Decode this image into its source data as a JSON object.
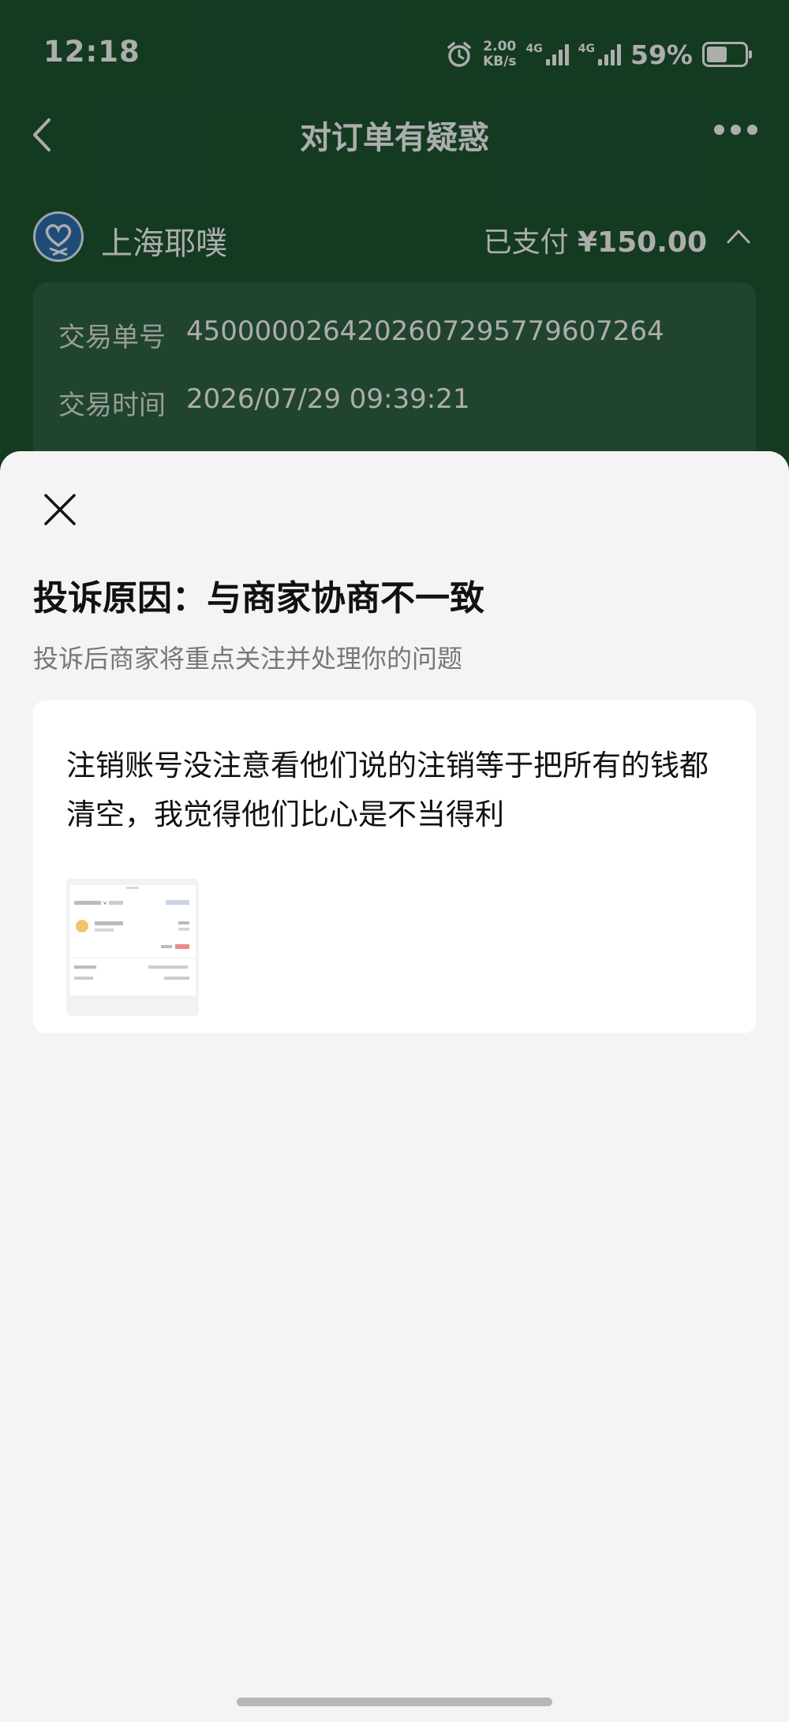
{
  "status_bar": {
    "time": "12:18",
    "net_speed_value": "2.00",
    "net_speed_unit": "KB/s",
    "sim1_tag": "4G",
    "sim2_tag": "4G",
    "battery_percent": "59%",
    "battery_level": 0.59
  },
  "navbar": {
    "title": "对订单有疑惑"
  },
  "merchant": {
    "name": "上海耶噗",
    "pay_status": "已支付",
    "amount": "¥150.00"
  },
  "order": {
    "trade_no_label": "交易单号",
    "trade_no": "4500000264202607295779607264",
    "trade_time_label": "交易时间",
    "trade_time": "2026/07/29 09:39:21"
  },
  "sheet": {
    "title": "投诉原因：与商家协商不一致",
    "subtitle": "投诉后商家将重点关注并处理你的问题",
    "complaint_text": "注销账号没注意看他们说的注销等于把所有的钱都清空，我觉得他们比心是不当得利"
  },
  "colors": {
    "header_green": "#1e5633",
    "sheet_bg": "#f4f4f4",
    "card_bg": "#ffffff"
  }
}
